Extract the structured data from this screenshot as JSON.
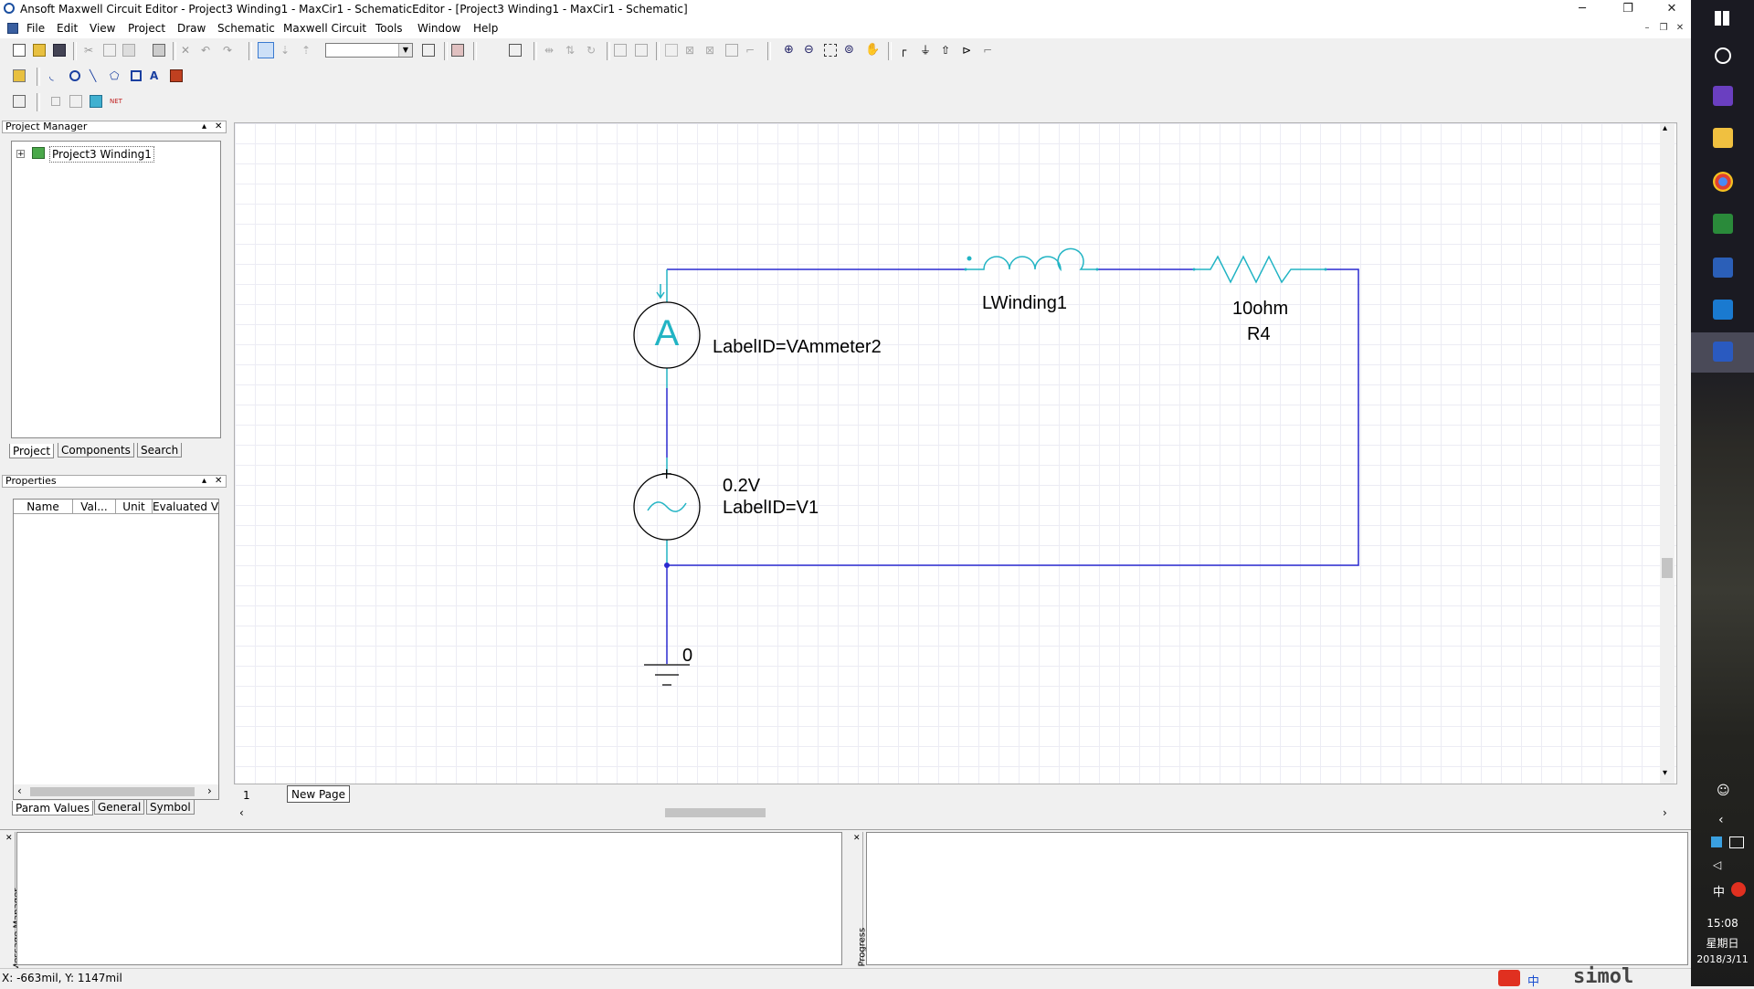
{
  "window": {
    "title": "Ansoft Maxwell Circuit Editor  - Project3 Winding1 - MaxCir1 - SchematicEditor - [Project3 Winding1 - MaxCir1 - Schematic]",
    "minimize": "─",
    "maximize": "❐",
    "close": "✕"
  },
  "menu": {
    "items": [
      "File",
      "Edit",
      "View",
      "Project",
      "Draw",
      "Schematic",
      "Maxwell Circuit",
      "Tools",
      "Window",
      "Help"
    ],
    "mdi_minimize": "–",
    "mdi_restore": "❐",
    "mdi_close": "✕"
  },
  "project_manager": {
    "title": "Project Manager",
    "pin": "▴",
    "close": "✕",
    "tree_expand": "+",
    "tree_root": "Project3 Winding1",
    "tabs": [
      "Project",
      "Components",
      "Search"
    ]
  },
  "properties": {
    "title": "Properties",
    "pin": "▴",
    "close": "✕",
    "columns": [
      "Name",
      "Val...",
      "Unit",
      "Evaluated Va..."
    ],
    "tabs": [
      "Param Values",
      "General",
      "Symbol"
    ],
    "scroll_left": "‹",
    "scroll_right": "›"
  },
  "schematic": {
    "ammeter_symbol": "A",
    "ammeter_label": "LabelID=VAmmeter2",
    "inductor_label": "LWinding1",
    "resistor_value": "10ohm",
    "resistor_name": "R4",
    "source_value": "0.2V",
    "source_label": "LabelID=V1",
    "source_plus": "+",
    "ground_label": "0",
    "page_number": "1",
    "page_tab": "New Page",
    "wire_color": "#2a2ad0",
    "component_color": "#22b4c4"
  },
  "bottom_panels": {
    "left_title": "Message Manager",
    "right_title": "Progress"
  },
  "status": {
    "coords": "X: -663mil, Y: 1147mil"
  },
  "taskbar": {
    "time": "15:08",
    "weekday": "星期日",
    "date": "2018/3/11",
    "ime_label": "中",
    "ime_label2": "中",
    "watermark": "simol"
  }
}
